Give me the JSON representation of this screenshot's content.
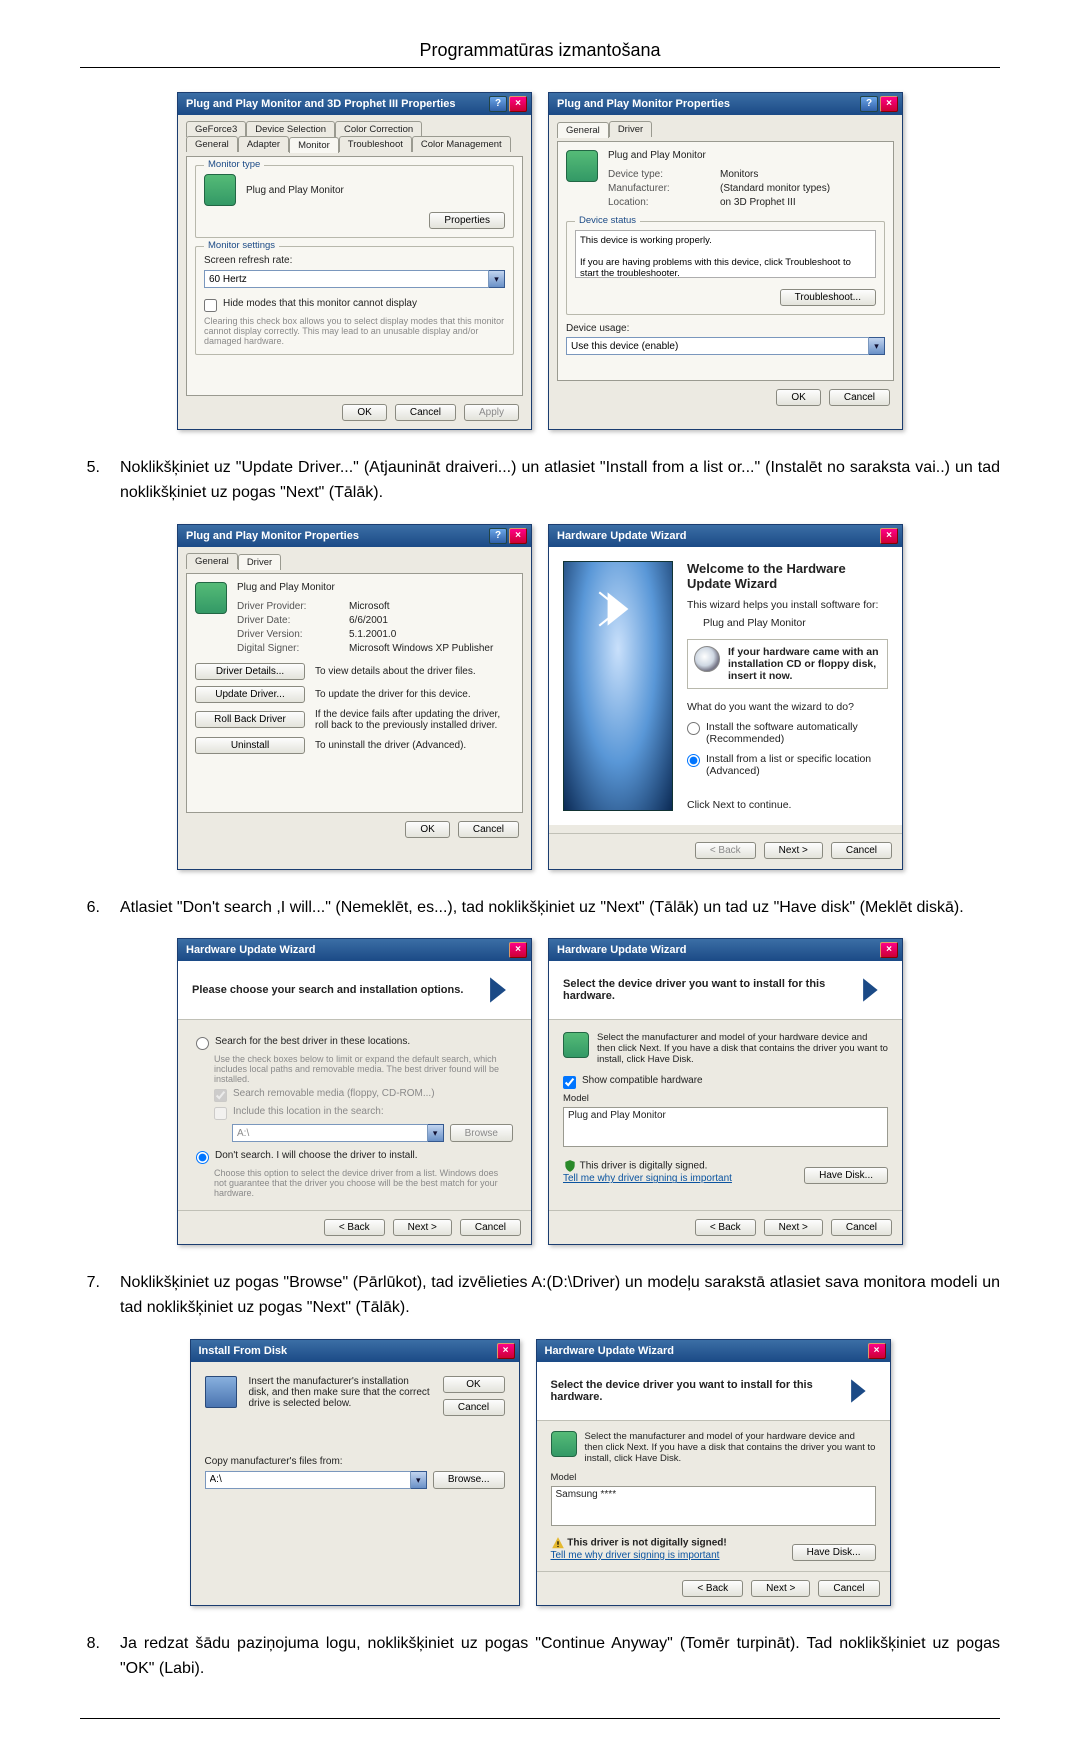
{
  "page": {
    "header": "Programmatūras izmantošana"
  },
  "steps": {
    "s5": {
      "num": "5.",
      "text": "Noklikšķiniet uz \"Update Driver...\" (Atjaunināt draiveri...) un atlasiet \"Install from a list or...\" (Instalēt no saraksta vai..) un tad noklikšķiniet uz pogas \"Next\" (Tālāk)."
    },
    "s6": {
      "num": "6.",
      "text": "Atlasiet \"Don't search ,I will...\" (Nemeklēt, es...), tad noklikšķiniet uz \"Next\" (Tālāk) un tad uz \"Have disk\" (Meklēt diskā)."
    },
    "s7": {
      "num": "7.",
      "text": "Noklikšķiniet uz pogas \"Browse\" (Pārlūkot), tad izvēlieties A:(D:\\Driver) un modeļu sarakstā atlasiet sava monitora modeli un tad noklikšķiniet uz pogas \"Next\" (Tālāk)."
    },
    "s8": {
      "num": "8.",
      "text": "Ja redzat šādu paziņojuma logu, noklikšķiniet uz pogas \"Continue Anyway\" (Tomēr turpināt). Tad noklikšķiniet uz pogas \"OK\" (Labi)."
    }
  },
  "dlg1a": {
    "title": "Plug and Play Monitor and 3D Prophet III Properties",
    "tabs1": [
      "GeForce3",
      "Device Selection",
      "Color Correction"
    ],
    "tabs2": [
      "General",
      "Adapter",
      "Monitor",
      "Troubleshoot",
      "Color Management"
    ],
    "grp_type": "Monitor type",
    "monitor_name": "Plug and Play Monitor",
    "btn_properties": "Properties",
    "grp_settings": "Monitor settings",
    "refresh_label": "Screen refresh rate:",
    "refresh_value": "60 Hertz",
    "hide_modes": "Hide modes that this monitor cannot display",
    "hide_desc": "Clearing this check box allows you to select display modes that this monitor cannot display correctly. This may lead to an unusable display and/or damaged hardware.",
    "ok": "OK",
    "cancel": "Cancel",
    "apply": "Apply"
  },
  "dlg1b": {
    "title": "Plug and Play Monitor Properties",
    "tabs": [
      "General",
      "Driver"
    ],
    "name": "Plug and Play Monitor",
    "k_type": "Device type:",
    "v_type": "Monitors",
    "k_manu": "Manufacturer:",
    "v_manu": "(Standard monitor types)",
    "k_loc": "Location:",
    "v_loc": "on 3D Prophet III",
    "grp_status": "Device status",
    "status_text": "This device is working properly.\n\nIf you are having problems with this device, click Troubleshoot to start the troubleshooter.",
    "btn_ts": "Troubleshoot...",
    "usage_label": "Device usage:",
    "usage_value": "Use this device (enable)",
    "ok": "OK",
    "cancel": "Cancel"
  },
  "dlg2a": {
    "title": "Plug and Play Monitor Properties",
    "tabs": [
      "General",
      "Driver"
    ],
    "name": "Plug and Play Monitor",
    "k_prov": "Driver Provider:",
    "v_prov": "Microsoft",
    "k_date": "Driver Date:",
    "v_date": "6/6/2001",
    "k_ver": "Driver Version:",
    "v_ver": "5.1.2001.0",
    "k_sig": "Digital Signer:",
    "v_sig": "Microsoft Windows XP Publisher",
    "btn_details": "Driver Details...",
    "desc_details": "To view details about the driver files.",
    "btn_update": "Update Driver...",
    "desc_update": "To update the driver for this device.",
    "btn_roll": "Roll Back Driver",
    "desc_roll": "If the device fails after updating the driver, roll back to the previously installed driver.",
    "btn_uninst": "Uninstall",
    "desc_uninst": "To uninstall the driver (Advanced).",
    "ok": "OK",
    "cancel": "Cancel"
  },
  "dlg2b": {
    "title": "Hardware Update Wizard",
    "heading": "Welcome to the Hardware Update Wizard",
    "line1": "This wizard helps you install software for:",
    "device": "Plug and Play Monitor",
    "cd_note": "If your hardware came with an installation CD or floppy disk, insert it now.",
    "question": "What do you want the wizard to do?",
    "opt1": "Install the software automatically (Recommended)",
    "opt2": "Install from a list or specific location (Advanced)",
    "cont": "Click Next to continue.",
    "back": "< Back",
    "next": "Next >",
    "cancel": "Cancel"
  },
  "dlg3a": {
    "title": "Hardware Update Wizard",
    "heading": "Please choose your search and installation options.",
    "opt1": "Search for the best driver in these locations.",
    "opt1_desc": "Use the check boxes below to limit or expand the default search, which includes local paths and removable media. The best driver found will be installed.",
    "chk1": "Search removable media (floppy, CD-ROM...)",
    "chk2": "Include this location in the search:",
    "path": "A:\\",
    "browse": "Browse",
    "opt2": "Don't search. I will choose the driver to install.",
    "opt2_desc": "Choose this option to select the device driver from a list. Windows does not guarantee that the driver you choose will be the best match for your hardware.",
    "back": "< Back",
    "next": "Next >",
    "cancel": "Cancel"
  },
  "dlg3b": {
    "title": "Hardware Update Wizard",
    "heading": "Select the device driver you want to install for this hardware.",
    "instr": "Select the manufacturer and model of your hardware device and then click Next. If you have a disk that contains the driver you want to install, click Have Disk.",
    "chk_compat": "Show compatible hardware",
    "model_label": "Model",
    "model_value": "Plug and Play Monitor",
    "signed": "This driver is digitally signed.",
    "tell": "Tell me why driver signing is important",
    "have_disk": "Have Disk...",
    "back": "< Back",
    "next": "Next >",
    "cancel": "Cancel"
  },
  "dlg4a": {
    "title": "Install From Disk",
    "instr": "Insert the manufacturer's installation disk, and then make sure that the correct drive is selected below.",
    "ok": "OK",
    "cancel": "Cancel",
    "copy_label": "Copy manufacturer's files from:",
    "path": "A:\\",
    "browse": "Browse..."
  },
  "dlg4b": {
    "title": "Hardware Update Wizard",
    "heading": "Select the device driver you want to install for this hardware.",
    "instr": "Select the manufacturer and model of your hardware device and then click Next. If you have a disk that contains the driver you want to install, click Have Disk.",
    "model_label": "Model",
    "model_value": "Samsung ****",
    "unsigned": "This driver is not digitally signed!",
    "tell": "Tell me why driver signing is important",
    "have_disk": "Have Disk...",
    "back": "< Back",
    "next": "Next >",
    "cancel": "Cancel"
  }
}
